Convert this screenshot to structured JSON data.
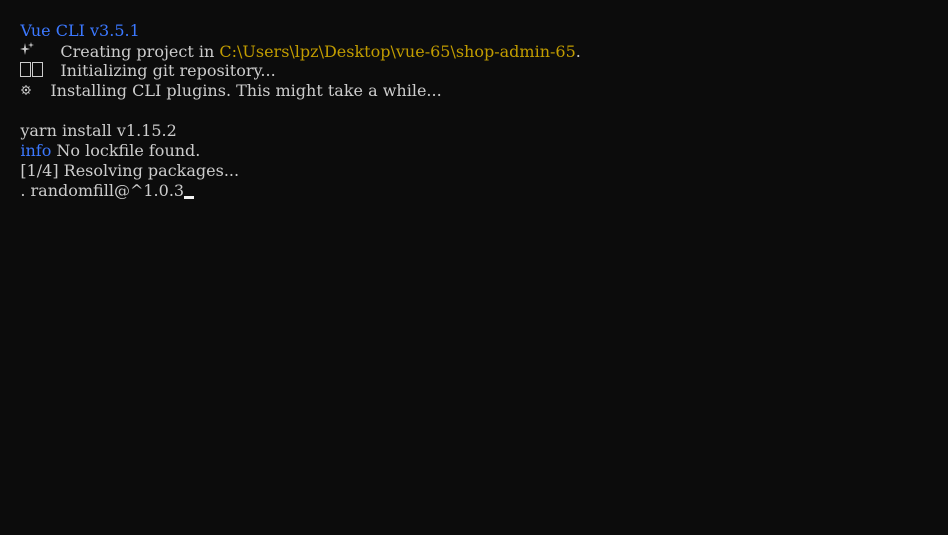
{
  "terminal": {
    "header": "Vue CLI v3.5.1",
    "creating": {
      "icon": "sparkle-icon",
      "prefix": "Creating project in ",
      "path": "C:\\Users\\lpz\\Desktop\\vue-65\\shop-admin-65",
      "suffix": "."
    },
    "git": {
      "icon": "git-box-icon",
      "text": "Initializing git repository..."
    },
    "plugins": {
      "icon": "gear-icon",
      "text": "Installing CLI plugins. This might take a while..."
    },
    "yarn_line": "yarn install v1.15.2",
    "info": {
      "tag": "info",
      "text": " No lockfile found."
    },
    "resolving": "[1/4] Resolving packages...",
    "progress": ". randomfill@^1.0.3"
  },
  "colors": {
    "background": "#0c0c0c",
    "foreground": "#cccccc",
    "blue": "#3b78ff",
    "yellow": "#c19c00"
  }
}
